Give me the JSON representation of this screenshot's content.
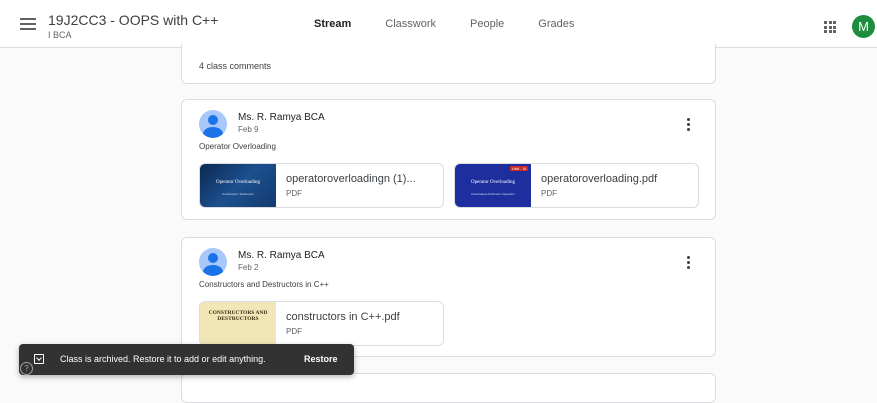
{
  "header": {
    "class_title": "19J2CC3 - OOPS with C++",
    "class_section": "I BCA",
    "tabs": [
      {
        "label": "Stream",
        "active": true
      },
      {
        "label": "Classwork",
        "active": false
      },
      {
        "label": "People",
        "active": false
      },
      {
        "label": "Grades",
        "active": false
      }
    ],
    "avatar_letter": "M",
    "avatar_color": "#1e8e3e",
    "menu_icon": "hamburger-menu-icon",
    "apps_icon": "google-apps-icon"
  },
  "stream": {
    "comments_label": "4 class comments",
    "posts": [
      {
        "author": "Ms. R. Ramya BCA",
        "date": "Feb 9",
        "text": "Operator Overloading",
        "attachments": [
          {
            "name": "operatoroverloadingn (1)...",
            "type": "PDF",
            "thumb_title": "Operator Overloading",
            "thumb_sub": "Constructor / Destructor"
          },
          {
            "name": "operatoroverloading.pdf",
            "type": "PDF",
            "thumb_title": "Operator Overloading",
            "thumb_sub": "Overloaded Arithmetic Operators",
            "thumb_badge": "Unit - III"
          }
        ]
      },
      {
        "author": "Ms. R. Ramya BCA",
        "date": "Feb 2",
        "text": "Constructors and Destructors in C++",
        "attachments": [
          {
            "name": "constructors in C++.pdf",
            "type": "PDF",
            "thumb_title": "CONSTRUCTORS AND DESTRUCTORS"
          }
        ]
      }
    ]
  },
  "toast": {
    "message": "Class is archived. Restore it to add or edit anything.",
    "action": "Restore"
  },
  "help_glyph": "?"
}
